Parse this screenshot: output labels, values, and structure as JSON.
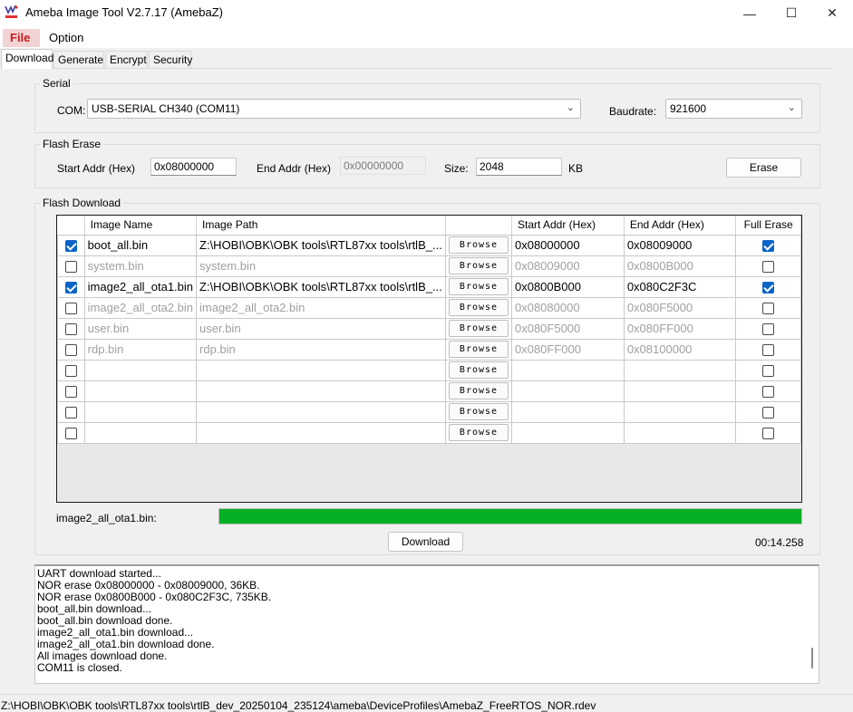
{
  "window": {
    "title": "Ameba Image Tool V2.7.17 (AmebaZ)",
    "minimize_glyph": "—",
    "maximize_glyph": "☐",
    "close_glyph": "✕"
  },
  "menu": {
    "file": "File",
    "option": "Option"
  },
  "tabs": {
    "download": "Download",
    "generate": "Generate",
    "encrypt": "Encrypt",
    "security": "Security",
    "active": "Download"
  },
  "serial": {
    "group_label": "Serial",
    "com_label": "COM:",
    "com_value": "USB-SERIAL CH340 (COM11)",
    "baud_label": "Baudrate:",
    "baud_value": "921600"
  },
  "erase": {
    "group_label": "Flash Erase",
    "start_label": "Start Addr (Hex)",
    "start_value": "0x08000000",
    "end_label": "End Addr (Hex)",
    "end_value": "0x00000000",
    "size_label": "Size:",
    "size_value": "2048",
    "unit": "KB",
    "button": "Erase"
  },
  "download": {
    "group_label": "Flash Download",
    "headers": {
      "name": "Image Name",
      "path": "Image Path",
      "browse": "",
      "start": "Start Addr (Hex)",
      "end": "End Addr (Hex)",
      "full": "Full Erase"
    },
    "browse_label": "Browse",
    "rows": [
      {
        "checked": true,
        "name": "boot_all.bin",
        "path": "Z:\\HOBI\\OBK\\OBK tools\\RTL87xx tools\\rtlB_...",
        "start": "0x08000000",
        "end": "0x08009000",
        "full": true,
        "muted": false
      },
      {
        "checked": false,
        "name": "system.bin",
        "path": "system.bin",
        "start": "0x08009000",
        "end": "0x0800B000",
        "full": false,
        "muted": true
      },
      {
        "checked": true,
        "name": "image2_all_ota1.bin",
        "path": "Z:\\HOBI\\OBK\\OBK tools\\RTL87xx tools\\rtlB_...",
        "start": "0x0800B000",
        "end": "0x080C2F3C",
        "full": true,
        "muted": false
      },
      {
        "checked": false,
        "name": "image2_all_ota2.bin",
        "path": "image2_all_ota2.bin",
        "start": "0x08080000",
        "end": "0x080F5000",
        "full": false,
        "muted": true
      },
      {
        "checked": false,
        "name": "user.bin",
        "path": "user.bin",
        "start": "0x080F5000",
        "end": "0x080FF000",
        "full": false,
        "muted": true
      },
      {
        "checked": false,
        "name": "rdp.bin",
        "path": "rdp.bin",
        "start": "0x080FF000",
        "end": "0x08100000",
        "full": false,
        "muted": true
      },
      {
        "checked": false,
        "name": "",
        "path": "",
        "start": "",
        "end": "",
        "full": false,
        "muted": false
      },
      {
        "checked": false,
        "name": "",
        "path": "",
        "start": "",
        "end": "",
        "full": false,
        "muted": false
      },
      {
        "checked": false,
        "name": "",
        "path": "",
        "start": "",
        "end": "",
        "full": false,
        "muted": false
      },
      {
        "checked": false,
        "name": "",
        "path": "",
        "start": "",
        "end": "",
        "full": false,
        "muted": false
      }
    ],
    "progress_label": "image2_all_ota1.bin:",
    "progress_value": 1.0,
    "progress_color": "#06b025",
    "button": "Download",
    "elapsed": "00:14.258"
  },
  "log": {
    "lines": [
      "UART download started...",
      "NOR erase 0x08000000 - 0x08009000, 36KB.",
      "NOR erase 0x0800B000 - 0x080C2F3C, 735KB.",
      "boot_all.bin download...",
      "boot_all.bin download done.",
      "image2_all_ota1.bin download...",
      "image2_all_ota1.bin download done.",
      "All images download done.",
      "COM11 is closed."
    ]
  },
  "status": {
    "path": "Z:\\HOBI\\OBK\\OBK tools\\RTL87xx tools\\rtlB_dev_20250104_235124\\ameba\\DeviceProfiles\\AmebaZ_FreeRTOS_NOR.rdev"
  },
  "colors": {
    "accent": "#0a64c8",
    "file_menu_bg": "#f1d3d3",
    "file_menu_fg": "#c41c1c"
  },
  "icons": {
    "app": "ameba-logo-icon",
    "combo": "chevron-down-icon"
  }
}
